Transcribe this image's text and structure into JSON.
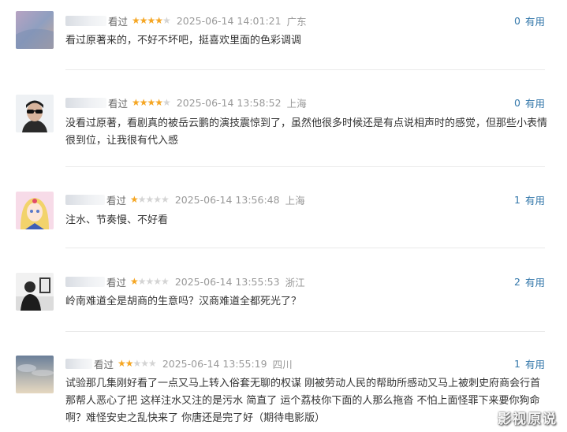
{
  "reviews": [
    {
      "verb": "看过",
      "rating": 4,
      "time": "2025-06-14 14:01:21",
      "location": "广东",
      "useful_count": "0",
      "useful_label": "有用",
      "content": "看过原著来的，不好不坏吧，挺喜欢里面的色彩调调"
    },
    {
      "verb": "看过",
      "rating": 4,
      "time": "2025-06-14 13:58:52",
      "location": "上海",
      "useful_count": "0",
      "useful_label": "有用",
      "content": "没看过原著，看剧真的被岳云鹏的演技震惊到了，虽然他很多时候还是有点说相声时的感觉，但那些小表情很到位，让我很有代入感"
    },
    {
      "verb": "看过",
      "rating": 1,
      "time": "2025-06-14 13:56:48",
      "location": "上海",
      "useful_count": "1",
      "useful_label": "有用",
      "content": "注水、节奏慢、不好看"
    },
    {
      "verb": "看过",
      "rating": 1,
      "time": "2025-06-14 13:55:53",
      "location": "浙江",
      "useful_count": "2",
      "useful_label": "有用",
      "content": "岭南难道全是胡商的生意吗？汉商难道全都死光了？"
    },
    {
      "verb": "看过",
      "rating": 2,
      "time": "2025-06-14 13:55:19",
      "location": "四川",
      "useful_count": "1",
      "useful_label": "有用",
      "content": "试验那几集刚好看了一点又马上转入俗套无聊的权谋 刚被劳动人民的帮助所感动又马上被刺史府商会行首那帮人恶心了把 这样注水又注的是污水 简直了 运个荔枝你下面的人那么拖沓 不怕上面怪罪下来要你狗命啊？难怪安史之乱快来了 你唐还是完了好（期待电影版）"
    }
  ],
  "star_full": "★",
  "star_empty": "★",
  "watermark": "影视原说",
  "colors": {
    "star": "#f5a623",
    "link": "#3377aa"
  }
}
